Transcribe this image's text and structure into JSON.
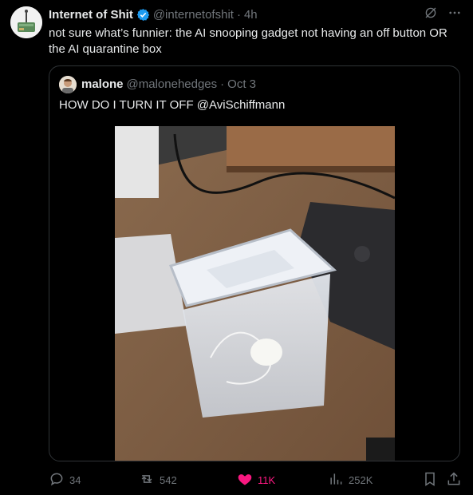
{
  "post": {
    "author_name": "Internet of Shit",
    "handle": "@internetofshit",
    "separator": "·",
    "time": "4h",
    "text": "not sure what’s funnier: the AI snooping gadget not having an off button OR the AI quarantine box"
  },
  "quoted_post": {
    "author_name": "malone",
    "handle": "@malonehedges",
    "separator": "·",
    "date": "Oct 3",
    "text": "HOW DO I TURN IT OFF @AviSchiffmann"
  },
  "actions": {
    "replies": "34",
    "reposts": "542",
    "likes": "11K",
    "views": "252K"
  },
  "colors": {
    "background": "#000000",
    "text": "#e7e9ea",
    "muted": "#71767b",
    "verified": "#1d9bf0",
    "like": "#f91880",
    "border": "#2f3336"
  },
  "icons": [
    "grok-icon",
    "more-icon",
    "verified-badge-icon",
    "reply-icon",
    "repost-icon",
    "heart-icon",
    "views-icon",
    "bookmark-icon",
    "share-icon"
  ]
}
